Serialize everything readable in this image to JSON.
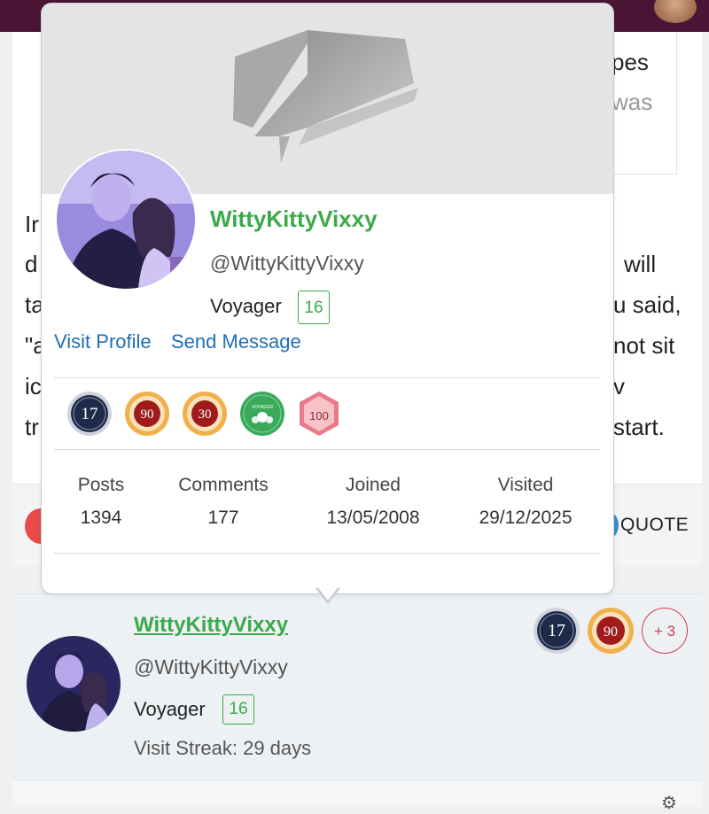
{
  "background_post": {
    "text_fragments": [
      "pes",
      "was",
      "Ir",
      "d",
      "will",
      "ta",
      "u said,",
      "\"a",
      "not sit",
      "ic",
      "v",
      "tr",
      "start."
    ],
    "quote_label": "QUOTE"
  },
  "hover_card": {
    "username": "WittyKittyVixxy",
    "handle": "@WittyKittyVixxy",
    "rank": "Voyager",
    "rank_level": "16",
    "visit_profile_label": "Visit Profile",
    "send_message_label": "Send Message",
    "badges": [
      {
        "name": "17-years-badge",
        "label": "17"
      },
      {
        "name": "90-badge",
        "label": "90"
      },
      {
        "name": "30-badge",
        "label": "30"
      },
      {
        "name": "voyager-badge",
        "label": "VOYAGER"
      },
      {
        "name": "100-badge",
        "label": "100"
      }
    ],
    "stats": [
      {
        "label": "Posts",
        "value": "1394"
      },
      {
        "label": "Comments",
        "value": "177"
      },
      {
        "label": "Joined",
        "value": "13/05/2008"
      },
      {
        "label": "Visited",
        "value": "29/12/2025"
      }
    ]
  },
  "post_author": {
    "username": "WittyKittyVixxy",
    "handle": "@WittyKittyVixxy",
    "rank": "Voyager",
    "rank_level": "16",
    "visit_streak": "Visit Streak: 29 days",
    "badges": [
      {
        "name": "17-years-badge",
        "label": "17"
      },
      {
        "name": "90-badge",
        "label": "90"
      }
    ],
    "more_badges": "+ 3"
  },
  "colors": {
    "topbar": "#4a1535",
    "username_green": "#3aaa4a",
    "link_blue": "#1e6fb8",
    "more_badges_red": "#d23a55"
  }
}
